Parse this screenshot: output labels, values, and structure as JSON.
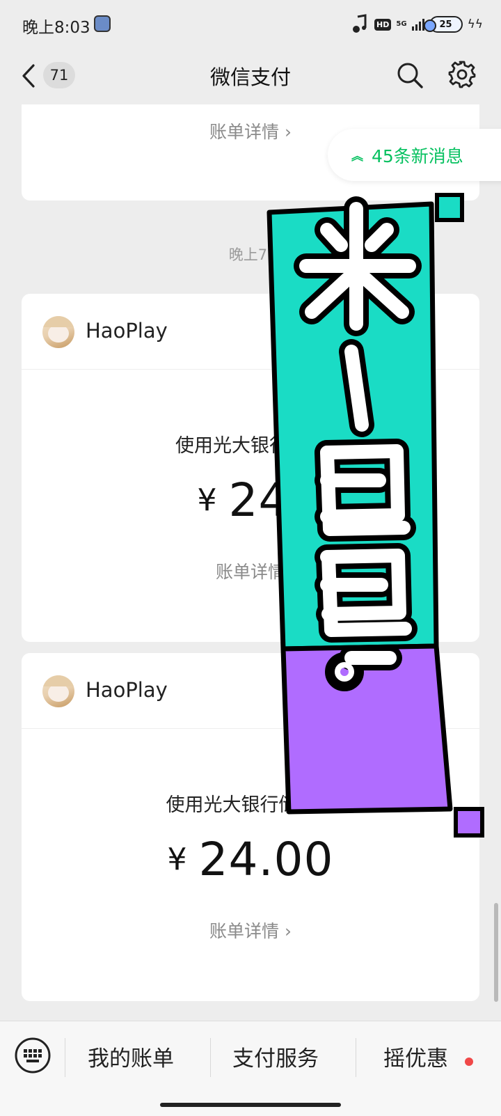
{
  "status_bar": {
    "time": "晚上8:03",
    "hd": "HD",
    "network": "5G",
    "battery": "25"
  },
  "nav": {
    "unread_count": "71",
    "title": "微信支付"
  },
  "new_messages": {
    "label": "45条新消息"
  },
  "top_card": {
    "bill_link": "账单详情 ›"
  },
  "time_label": "晚上7:",
  "payments": [
    {
      "merchant": "HaoPlay",
      "description": "使用光大银行储蓄",
      "currency": "¥",
      "amount": "24.",
      "bill_link": "账单详情"
    },
    {
      "merchant": "HaoPlay",
      "description": "使用光大银行储蓄卡",
      "currency": "¥",
      "amount": "24.00",
      "bill_link": "账单详情 ›"
    }
  ],
  "overlay": {
    "text": "米一包包!",
    "colors": {
      "top": "#1adcc5",
      "bottom": "#b06cff",
      "outline": "#000000",
      "letters": "#ffffff"
    }
  },
  "toolbar": {
    "bill": "我的账单",
    "service": "支付服务",
    "offers": "摇优惠"
  },
  "colors": {
    "accent": "#07c160",
    "background": "#ededed",
    "dot": "#f04848"
  }
}
